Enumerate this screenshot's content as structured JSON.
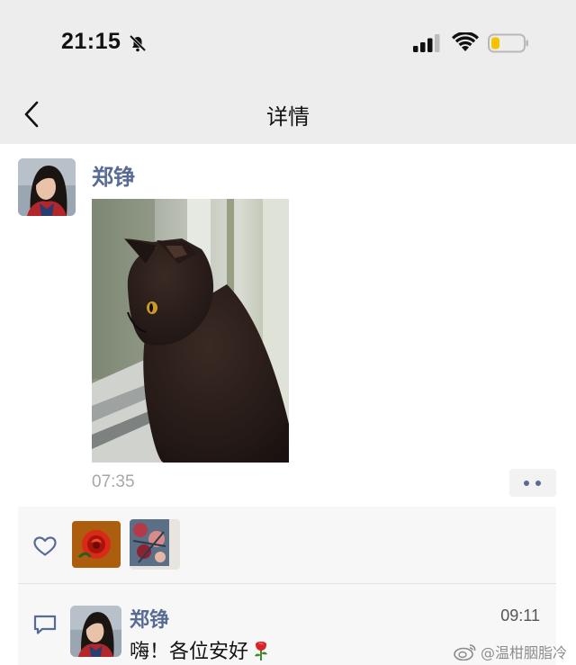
{
  "status_bar": {
    "time": "21:15",
    "icons": [
      "bell-off-icon",
      "signal-icon",
      "wifi-icon",
      "battery-low-icon"
    ],
    "battery_color": "#f5c400"
  },
  "nav": {
    "title": "详情",
    "back_icon": "chevron-left-icon"
  },
  "post": {
    "author": "郑铮",
    "avatar_icon": "user-avatar",
    "photo": "black-cat-photo",
    "time": "07:35",
    "more_icon": "ellipsis-icon"
  },
  "likes": {
    "icon": "heart-outline-icon",
    "avatars": [
      "rose-avatar",
      "floral-avatar"
    ]
  },
  "comments": [
    {
      "author": "郑铮",
      "time": "09:11",
      "text": "嗨！各位安好",
      "emoji": "rose-emoji"
    }
  ],
  "watermark": {
    "text": "@温柑胭脂冷",
    "icon": "weibo-icon"
  },
  "colors": {
    "link_blue": "#576b95",
    "header_gray": "#ededed",
    "panel_gray": "#f7f7f7",
    "timestamp_gray": "#a7a7a7"
  }
}
